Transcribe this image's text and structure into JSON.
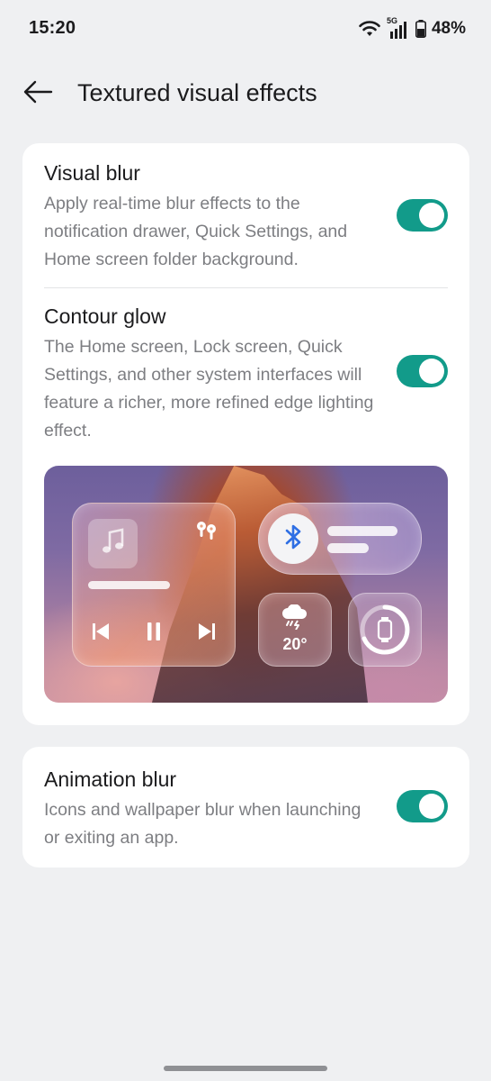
{
  "status_bar": {
    "time": "15:20",
    "network": "5G",
    "battery": "48%",
    "icons": [
      "wifi-icon",
      "signal-icon",
      "battery-icon"
    ]
  },
  "header": {
    "back_icon": "arrow-left-icon",
    "title": "Textured visual effects"
  },
  "settings": [
    {
      "title": "Visual blur",
      "description": "Apply real-time blur effects to the notification drawer, Quick Settings, and Home screen folder background.",
      "enabled": true
    },
    {
      "title": "Contour glow",
      "description": "The Home screen, Lock screen, Quick Settings, and other system interfaces will feature a richer, more refined edge lighting effect.",
      "enabled": true
    },
    {
      "title": "Animation blur",
      "description": "Icons and wallpaper blur when launching or exiting an app.",
      "enabled": true
    }
  ],
  "preview": {
    "weather_temp": "20°",
    "icons": [
      "music-note-icon",
      "earbuds-icon",
      "previous-track-icon",
      "pause-icon",
      "next-track-icon",
      "bluetooth-icon",
      "thunderstorm-icon",
      "smartwatch-icon"
    ]
  },
  "colors": {
    "toggle_on": "#129b8a",
    "background": "#eff0f2",
    "card": "#ffffff",
    "bluetooth": "#2f6fe4"
  }
}
